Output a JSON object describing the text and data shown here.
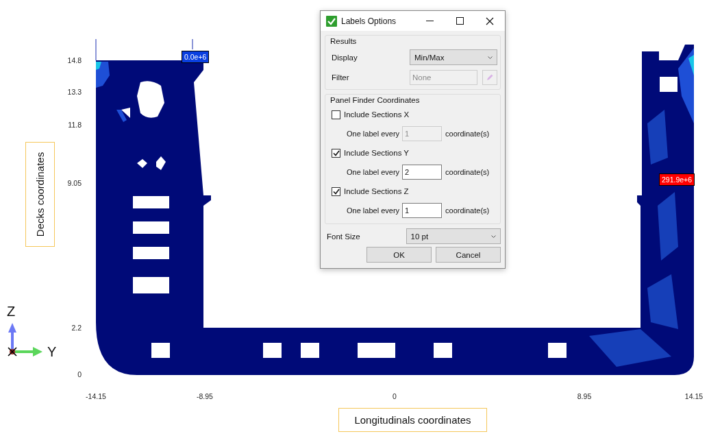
{
  "viewport": {
    "y_ticks": [
      "14.8",
      "13.3",
      "11.8",
      "9.05",
      "2.2",
      "0"
    ],
    "x_ticks": [
      "-14.15",
      "-8.95",
      "0",
      "8.95",
      "14.15"
    ],
    "y_axis_title": "Decks coordinates",
    "x_axis_title": "Longitudinals coordinates",
    "min_label": "0.0e+6",
    "max_label": "291.9e+6",
    "triad": {
      "z": "Z",
      "y": "Y"
    }
  },
  "dialog": {
    "title": "Labels Options",
    "results": {
      "heading": "Results",
      "display": {
        "label": "Display",
        "value": "Min/Max"
      },
      "filter": {
        "label": "Filter",
        "value": "None",
        "disabled": true
      }
    },
    "finder": {
      "heading": "Panel Finder Coordinates",
      "sections": [
        {
          "label": "Include Sections X",
          "checked": false,
          "every_label": "One label every",
          "value": "1",
          "unit": "coordinate(s)"
        },
        {
          "label": "Include Sections Y",
          "checked": true,
          "every_label": "One label every",
          "value": "2",
          "unit": "coordinate(s)"
        },
        {
          "label": "Include Sections Z",
          "checked": true,
          "every_label": "One label every",
          "value": "1",
          "unit": "coordinate(s)"
        }
      ]
    },
    "font_size": {
      "label": "Font Size",
      "value": "10 pt"
    },
    "buttons": [
      "OK",
      "Cancel"
    ]
  }
}
